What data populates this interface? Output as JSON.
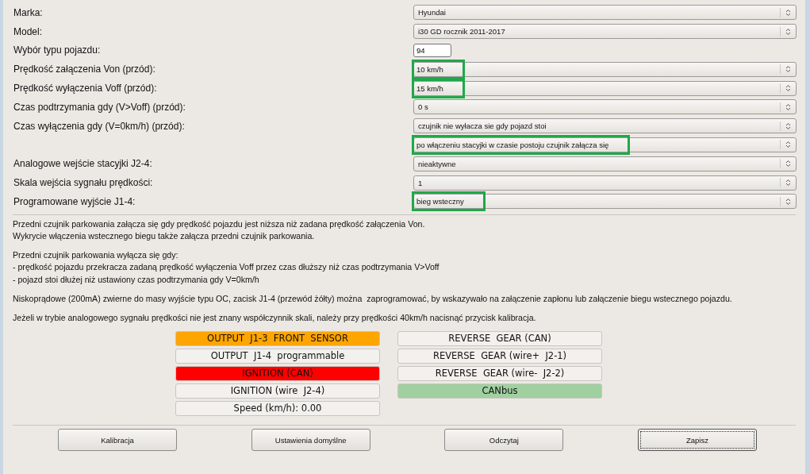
{
  "settings": [
    {
      "label": "Marka:",
      "kind": "select",
      "value": "Hyundai",
      "highlighted": false
    },
    {
      "label": "Model:",
      "kind": "select",
      "value": "i30 GD rocznik 2011-2017",
      "highlighted": false
    },
    {
      "label": "Wybór typu pojazdu:",
      "kind": "text",
      "value": "94",
      "highlighted": false
    },
    {
      "label": "Prędkość załączenia Von (przód):",
      "kind": "select",
      "value": "10 km/h",
      "highlighted": true
    },
    {
      "label": "Prędkość wyłączenia Voff (przód):",
      "kind": "select",
      "value": "15 km/h",
      "highlighted": true
    },
    {
      "label": "Czas podtrzymania gdy (V>Voff) (przód):",
      "kind": "select",
      "value": "0 s",
      "highlighted": false
    },
    {
      "label": "Czas wyłączenia gdy (V=0km/h) (przód):",
      "kind": "select",
      "value": "czujnik nie wyłacza sie gdy pojazd stoi",
      "highlighted": false
    },
    {
      "kind": "select",
      "value": "po włączeniu stacyjki w czasie postoju czujnik załącza się",
      "highlighted": true
    },
    {
      "label": "Analogowe wejście stacyjki J2-4:",
      "kind": "select",
      "value": "nieaktywne",
      "highlighted": false
    },
    {
      "label": "Skala wejścia sygnału prędkości:",
      "kind": "select",
      "value": "1",
      "highlighted": false
    },
    {
      "label": "Programowane wyjście J1-4:",
      "kind": "select",
      "value": "bieg wsteczny",
      "highlighted": true
    }
  ],
  "description": [
    [
      "Przedni czujnik parkowania załącza się gdy prędkość pojazdu jest niższa niż zadana prędkość załączenia Von.",
      "Wykrycie włączenia wstecznego biegu także załącza przedni czujnik parkowania."
    ],
    [
      "Przedni czujnik parkowania wyłącza się gdy:",
      "- prędkość pojazdu przekracza zadaną prędkość wyłączenia Voff przez czas dłuższy niż czas podtrzymania V>Voff",
      "- pojazd stoi dłużej niż ustawiony czas podtrzymania gdy V=0km/h"
    ],
    [
      "Niskoprądowe (200mA) zwierne do masy wyjście typu OC, zacisk J1-4 (przewód żółty) można  zaprogramować, by wskazywało na załączenie zapłonu lub załączenie biegu wstecznego pojazdu."
    ],
    [
      "Jeżeli w trybie analogowego sygnału prędkości nie jest znany współczynnik skali, należy przy prędkości 40km/h nacisnąć przycisk kalibracja."
    ]
  ],
  "indicators_left": [
    {
      "label": "OUTPUT  J1-3  FRONT  SENSOR",
      "color": "#ffa500"
    },
    {
      "label": "OUTPUT  J1-4  programmable",
      "color": "#f3f1ee"
    },
    {
      "label": "IGNITION (CAN)",
      "color": "#ff0000"
    },
    {
      "label": "IGNITION (wire  J2-4)",
      "color": "#f3f1ee"
    },
    {
      "label": "Speed (km/h): 0.00",
      "color": "#f3f1ee"
    }
  ],
  "indicators_right": [
    {
      "label": "REVERSE  GEAR (CAN)",
      "color": "#f3f1ee"
    },
    {
      "label": "REVERSE  GEAR (wire+  J2-1)",
      "color": "#f3f1ee"
    },
    {
      "label": "REVERSE  GEAR (wire-  J2-2)",
      "color": "#f3f1ee"
    },
    {
      "label": "CANbus",
      "color": "#a0d0a0"
    }
  ],
  "buttons": [
    {
      "label": "Kalibracja",
      "focused": false
    },
    {
      "label": "Ustawienia domyślne",
      "focused": false
    },
    {
      "label": "Odczytaj",
      "focused": false
    },
    {
      "label": "Zapisz",
      "focused": true
    }
  ]
}
